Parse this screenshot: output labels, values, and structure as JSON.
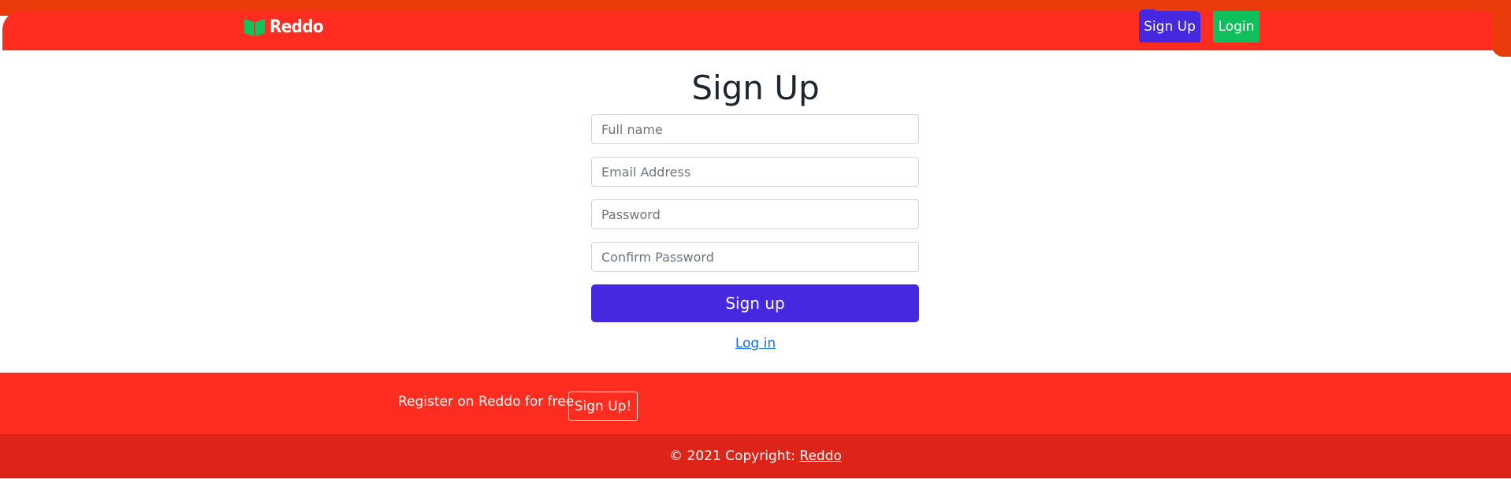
{
  "header": {
    "brand_name": "Reddo",
    "signup_label": "Sign Up",
    "login_label": "Login"
  },
  "form": {
    "title": "Sign Up",
    "full_name_placeholder": "Full name",
    "email_placeholder": "Email Address",
    "password_placeholder": "Password",
    "confirm_password_placeholder": "Confirm Password",
    "submit_label": "Sign up",
    "login_link": "Log in"
  },
  "footer": {
    "cta_text": "Register on Reddo for free",
    "cta_button": "Sign Up!",
    "copyright_prefix": "© 2021 Copyright:",
    "copyright_link": "Reddo"
  },
  "colors": {
    "header_red": "#ff2d20",
    "accent_purple": "#4628e0",
    "login_green": "#0fbf5b",
    "footer_dark_red": "#dd2418"
  },
  "icons": {
    "brand": "open-book-icon"
  }
}
